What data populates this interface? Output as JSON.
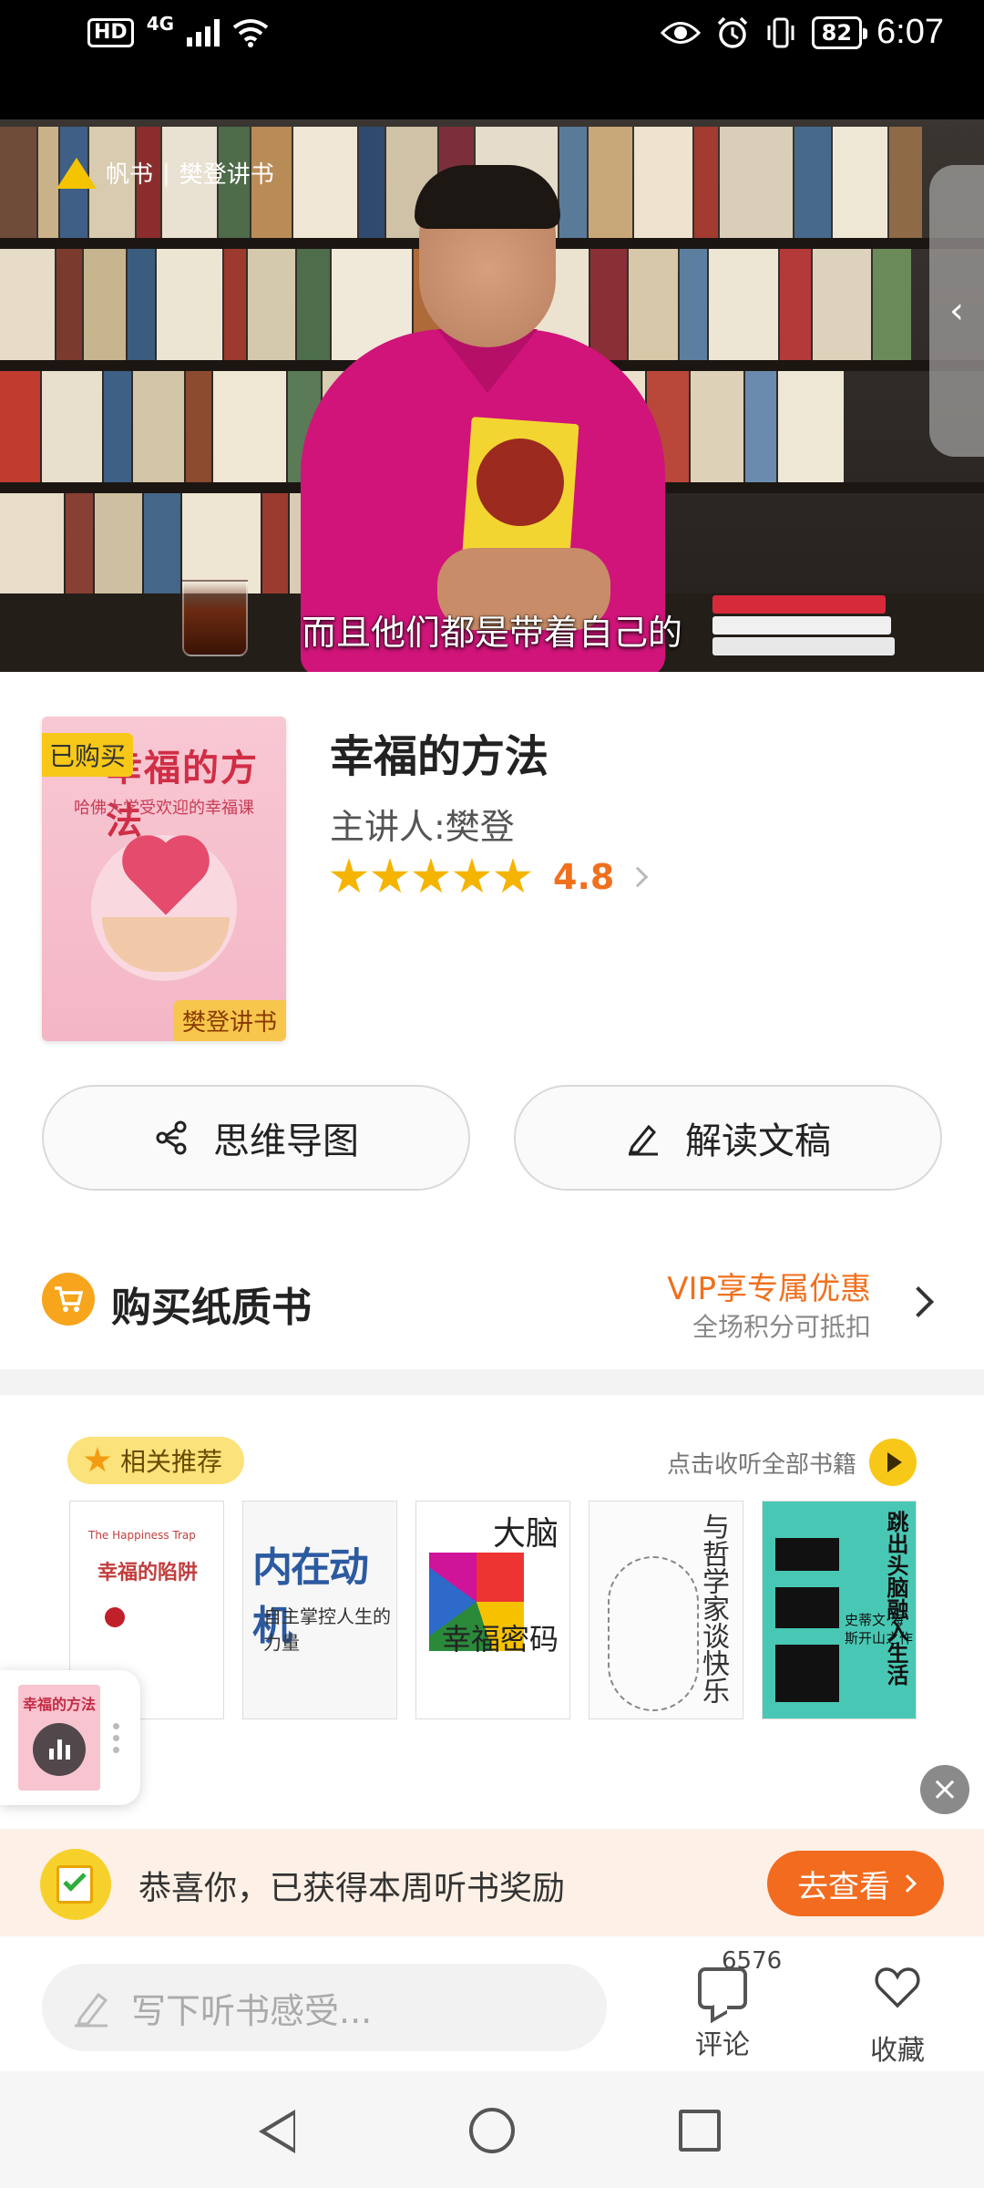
{
  "status_bar": {
    "hd": "HD",
    "network": "4G",
    "battery": "82",
    "time": "6:07"
  },
  "video": {
    "brand_name": "帆书",
    "brand_channel": "樊登讲书",
    "subtitle": "而且他们都是带着自己的"
  },
  "book": {
    "cover_title": "幸福的方法",
    "cover_subtitle": "哈佛大学受欢迎的幸福课",
    "cover_badge": "樊登讲书",
    "purchased_tag": "已购买",
    "title": "幸福的方法",
    "speaker": "主讲人:樊登",
    "rating": "4.8",
    "stars": 5
  },
  "actions": {
    "mindmap": "思维导图",
    "transcript": "解读文稿"
  },
  "buy": {
    "label": "购买纸质书",
    "vip_offer": "VIP享专属优惠",
    "vip_note": "全场积分可抵扣"
  },
  "recommend": {
    "tag": "相关推荐",
    "listen_all": "点击收听全部书籍",
    "books": [
      {
        "title": "幸福的陷阱",
        "en": "The Happiness Trap"
      },
      {
        "title": "内在动机",
        "sub": "自主掌控人生的力量"
      },
      {
        "title_a": "大脑",
        "title_b": "幸福密码"
      },
      {
        "title": "与哲学家谈快乐"
      },
      {
        "title": "跳出头脑融入生活",
        "sub": "史蒂文·海斯开山之作"
      }
    ]
  },
  "mini_player": {
    "title": "幸福的方法"
  },
  "reward": {
    "text": "恭喜你，已获得本周听书奖励",
    "button": "去查看"
  },
  "bottom_bar": {
    "input_placeholder": "写下听书感受...",
    "comment_count": "6576",
    "comment_label": "评论",
    "favorite_label": "收藏"
  }
}
